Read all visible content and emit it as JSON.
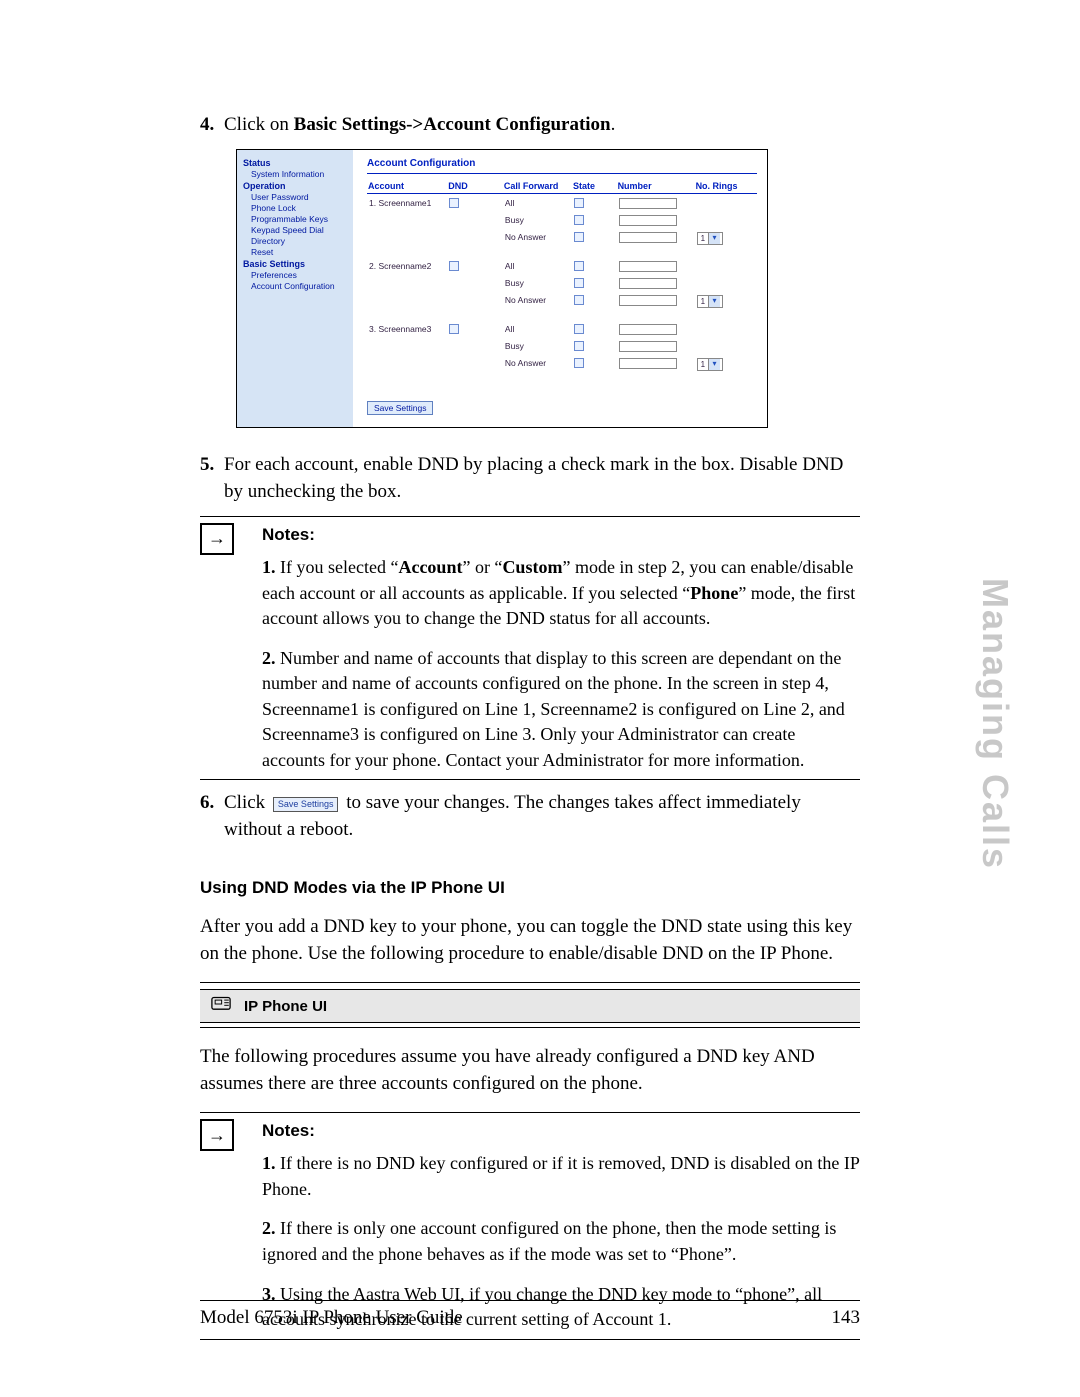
{
  "side_title": "Managing Calls",
  "footer": {
    "left": "Model 6753i IP Phone User Guide",
    "right": "143"
  },
  "step4": {
    "num": "4.",
    "pre": "Click on ",
    "bold": "Basic Settings->Account Configuration",
    "post": "."
  },
  "emb": {
    "nav": {
      "sections": [
        {
          "header": "Status",
          "items": [
            "System Information"
          ]
        },
        {
          "header": "Operation",
          "items": [
            "User Password",
            "Phone Lock",
            "Programmable Keys",
            "Keypad Speed Dial",
            "Directory",
            "Reset"
          ]
        },
        {
          "header": "Basic Settings",
          "items": [
            "Preferences",
            "Account Configuration"
          ]
        }
      ]
    },
    "title": "Account Configuration",
    "headers": [
      "Account",
      "DND",
      "Call Forward",
      "State",
      "Number",
      "No. Rings"
    ],
    "accounts": [
      {
        "label": "1. Screenname1",
        "rows": [
          "All",
          "Busy",
          "No Answer"
        ],
        "rings": "1"
      },
      {
        "label": "2. Screenname2",
        "rows": [
          "All",
          "Busy",
          "No Answer"
        ],
        "rings": "1"
      },
      {
        "label": "3. Screenname3",
        "rows": [
          "All",
          "Busy",
          "No Answer"
        ],
        "rings": "1"
      }
    ],
    "save_label": "Save Settings"
  },
  "step5": {
    "num": "5.",
    "text": "For each account, enable DND by placing a check mark in the box. Disable DND by unchecking the box."
  },
  "notes1": {
    "title": "Notes:",
    "items": [
      {
        "n": "1.",
        "pre": "If you selected “",
        "b1": "Account",
        "mid1": "” or “",
        "b2": "Custom",
        "mid2": "” mode in step 2, you can enable/disable each account or all accounts as applicable. If you selected “",
        "b3": "Phone",
        "post": "” mode, the first account allows you to change the DND status for all accounts."
      },
      {
        "n": "2.",
        "text": "Number and name of accounts that display to this screen are dependant on the number and name of accounts configured on the phone. In the screen in step 4, Screenname1 is configured on Line 1, Screenname2 is configured on Line 2, and Screenname3 is configured on Line 3. Only your Administrator can create accounts for your phone. Contact your Administrator for more information."
      }
    ]
  },
  "step6": {
    "num": "6.",
    "pre": "Click ",
    "btn": "Save Settings",
    "post": " to save your changes. The changes takes affect immediately without a reboot."
  },
  "section_using": "Using DND Modes via the IP Phone UI",
  "para_after_using": "After you add a DND key to your phone, you can toggle the DND state using this key on the phone. Use the following procedure to enable/disable DND on the IP Phone.",
  "ui_bar_label": "IP Phone UI",
  "para_procedures": "The following procedures assume you have already configured a DND key AND assumes there are three accounts configured on the phone.",
  "notes2": {
    "title": "Notes:",
    "items": [
      {
        "n": "1.",
        "text": "If there is no DND key configured or if it is removed, DND is disabled on the IP Phone."
      },
      {
        "n": "2.",
        "text": "If there is only one account configured on the phone, then the mode setting is ignored and the phone behaves as if the mode was set to “Phone”."
      },
      {
        "n": "3.",
        "text": "Using the Aastra Web UI, if you change the DND key mode to “phone”, all accounts synchronize to the current setting of Account 1."
      }
    ]
  }
}
